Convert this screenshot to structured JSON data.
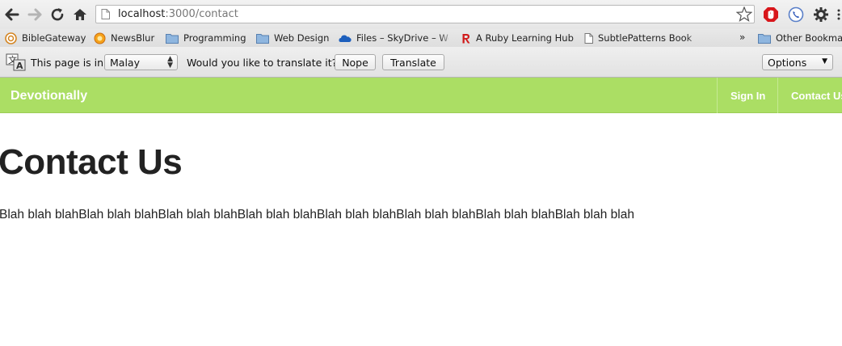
{
  "browser": {
    "url_host": "localhost",
    "url_rest": ":3000/contact",
    "bookmarks": [
      {
        "label": "BibleGateway",
        "icon": "biblegateway-icon"
      },
      {
        "label": "NewsBlur",
        "icon": "newsblur-icon"
      },
      {
        "label": "Programming",
        "icon": "folder-icon"
      },
      {
        "label": "Web Design",
        "icon": "folder-icon"
      },
      {
        "label": "Files – SkyDrive – Wo",
        "icon": "skydrive-icon"
      },
      {
        "label": "A Ruby Learning Hub",
        "icon": "ruby-icon"
      },
      {
        "label": "SubtlePatterns Bookm",
        "icon": "page-icon"
      }
    ],
    "bookmarks_more": "»",
    "other_bookmarks": "Other Bookmar"
  },
  "translate_bar": {
    "prefix": "This page is in",
    "language": "Malay",
    "question": "Would you like to translate it?",
    "nope": "Nope",
    "translate": "Translate",
    "options": "Options"
  },
  "site": {
    "brand": "Devotionally",
    "nav": [
      {
        "label": "Sign In"
      },
      {
        "label": "Contact Us"
      }
    ],
    "heading": "Contact Us",
    "body": "Blah blah blahBlah blah blahBlah blah blahBlah blah blahBlah blah blahBlah blah blahBlah blah blahBlah blah blah"
  },
  "colors": {
    "nav_bg": "#abde64",
    "nav_text": "#ffffff",
    "heading": "#222222"
  }
}
